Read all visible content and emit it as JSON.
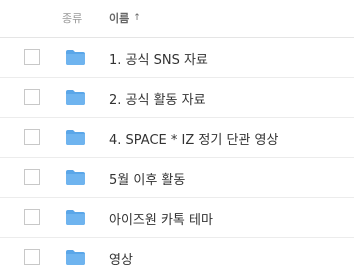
{
  "header": {
    "type_label": "종류",
    "name_label": "이름",
    "sort_indicator": "↑"
  },
  "colors": {
    "folder": "#6fb4ef",
    "folder_tab": "#5aa6e8",
    "text": "#333333",
    "header_text": "#999999"
  },
  "rows": [
    {
      "icon": "folder-icon",
      "name": "1. 공식 SNS 자료"
    },
    {
      "icon": "folder-icon",
      "name": "2. 공식 활동 자료"
    },
    {
      "icon": "folder-icon",
      "name": "4. SPACE * IZ 정기 단관 영상"
    },
    {
      "icon": "folder-icon",
      "name": "5월 이후 활동"
    },
    {
      "icon": "folder-icon",
      "name": "아이즈원 카톡 테마"
    },
    {
      "icon": "folder-icon",
      "name": "영상"
    }
  ]
}
